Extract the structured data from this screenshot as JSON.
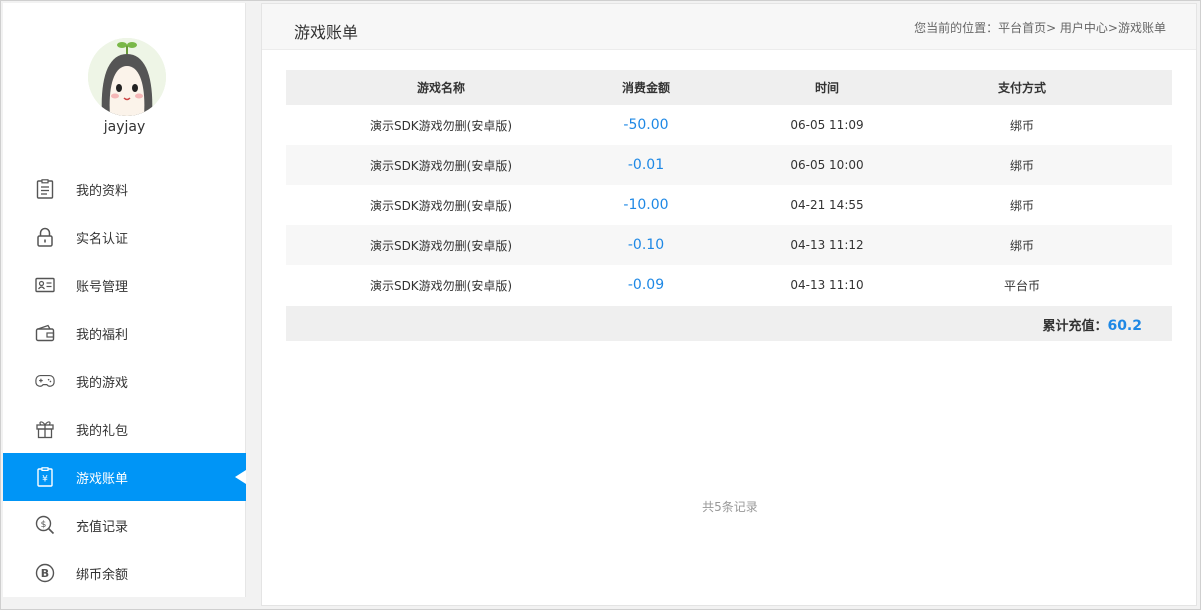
{
  "user": {
    "name": "jayjay"
  },
  "sidebar": {
    "items": [
      {
        "label": "我的资料",
        "icon": "profile-icon"
      },
      {
        "label": "实名认证",
        "icon": "lock-icon"
      },
      {
        "label": "账号管理",
        "icon": "id-card-icon"
      },
      {
        "label": "我的福利",
        "icon": "wallet-icon"
      },
      {
        "label": "我的游戏",
        "icon": "gamepad-icon"
      },
      {
        "label": "我的礼包",
        "icon": "gift-icon"
      },
      {
        "label": "游戏账单",
        "icon": "bill-icon",
        "active": true
      },
      {
        "label": "充值记录",
        "icon": "coin-search-icon"
      },
      {
        "label": "绑币余额",
        "icon": "bitcoin-icon"
      }
    ]
  },
  "header": {
    "title": "游戏账单",
    "breadcrumb": "您当前的位置：平台首页> 用户中心>游戏账单"
  },
  "table": {
    "columns": [
      "游戏名称",
      "消费金额",
      "时间",
      "支付方式"
    ],
    "rows": [
      {
        "name": "演示SDK游戏勿删(安卓版)",
        "amount": "-50.00",
        "time": "06-05 11:09",
        "pay": "绑币"
      },
      {
        "name": "演示SDK游戏勿删(安卓版)",
        "amount": "-0.01",
        "time": "06-05 10:00",
        "pay": "绑币"
      },
      {
        "name": "演示SDK游戏勿删(安卓版)",
        "amount": "-10.00",
        "time": "04-21 14:55",
        "pay": "绑币"
      },
      {
        "name": "演示SDK游戏勿删(安卓版)",
        "amount": "-0.10",
        "time": "04-13 11:12",
        "pay": "绑币"
      },
      {
        "name": "演示SDK游戏勿删(安卓版)",
        "amount": "-0.09",
        "time": "04-13 11:10",
        "pay": "平台币"
      }
    ]
  },
  "total": {
    "label": "累计充值：",
    "value": "60.2"
  },
  "footer": {
    "record_count": "共5条记录"
  },
  "colors": {
    "accent": "#0095f6",
    "amount": "#1e88e5"
  }
}
